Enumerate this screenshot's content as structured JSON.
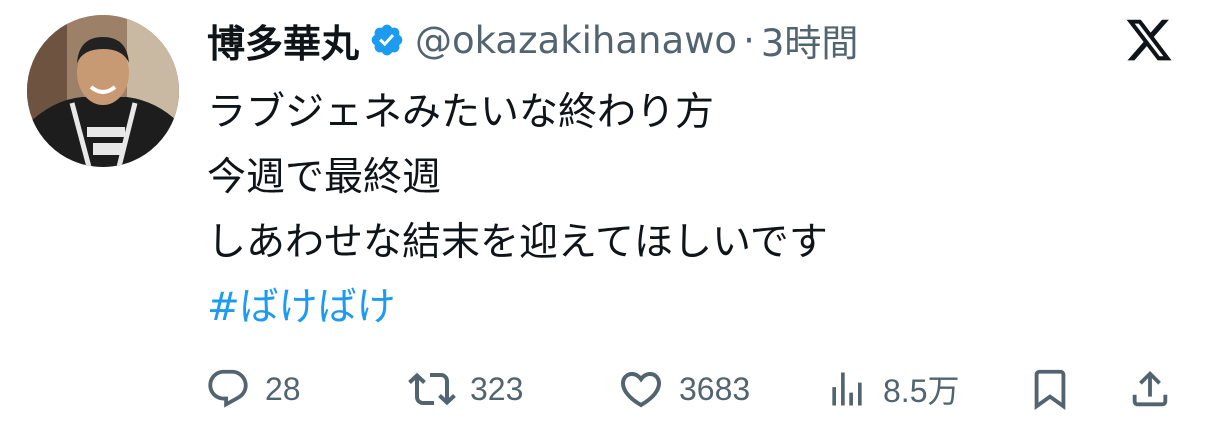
{
  "tweet": {
    "author": {
      "display_name": "博多華丸",
      "handle": "@okazakihanawo",
      "verified": true,
      "avatar_icon": "avatar-photo-icon"
    },
    "separator": "·",
    "timestamp": "3時間",
    "platform_icon": "x-logo-icon",
    "body_lines": [
      "ラブジェネみたいな終わり方",
      "今週で最終週",
      "しあわせな結末を迎えてほしいです"
    ],
    "hashtag": "#ばけばけ",
    "actions": {
      "replies": "28",
      "retweets": "323",
      "likes": "3683",
      "views": "8.5万"
    }
  },
  "colors": {
    "text_primary": "#0f1419",
    "text_secondary": "#536471",
    "accent": "#1d9bf0",
    "background": "#ffffff"
  }
}
